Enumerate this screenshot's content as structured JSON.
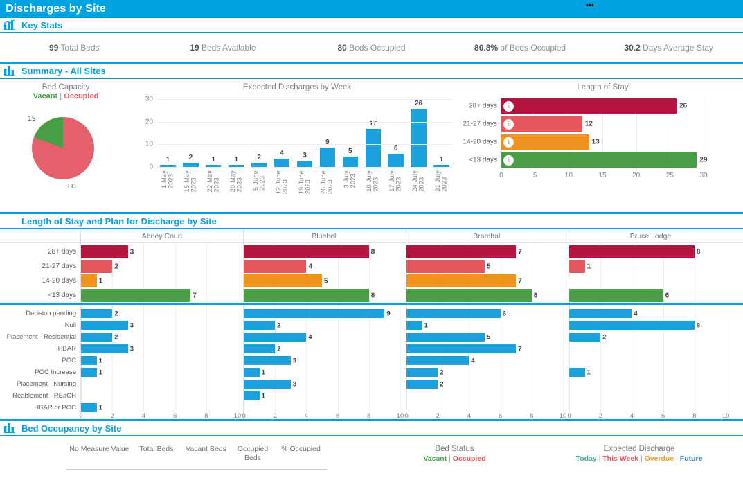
{
  "window": {
    "title": "Discharges by Site",
    "menu_glyph": "•••"
  },
  "key_stats": {
    "section_title": "Key Stats",
    "icon": "bar-chart-trend-icon",
    "stats": [
      {
        "value": "99",
        "label": "Total Beds"
      },
      {
        "value": "19",
        "label": "Beds Available"
      },
      {
        "value": "80",
        "label": "Beds Occupied"
      },
      {
        "value": "80.8%",
        "label": "of Beds Occupied"
      },
      {
        "value": "30.2",
        "label": "Days Average Stay"
      }
    ]
  },
  "summary": {
    "section_title": "Summary - All Sites",
    "icon": "bar-chart-icon",
    "bed_capacity": {
      "title": "Bed Capacity",
      "legend_vacant": "Vacant",
      "legend_sep": "|",
      "legend_occupied": "Occupied",
      "vacant_label": "19",
      "occupied_label": "80"
    }
  },
  "sites_section": {
    "section_title": "Length of Stay and Plan for Discharge by Site",
    "icon": "blank-icon",
    "site_names": [
      "Abney Court",
      "Bluebell",
      "Bramhall",
      "Bruce Lodge"
    ]
  },
  "occupancy": {
    "section_title": "Bed Occupancy by Site",
    "icon": "bar-chart-icon",
    "columns": [
      "No Measure Value",
      "Total Beds",
      "Vacant Beds",
      "Occupied Beds",
      "% Occupied"
    ],
    "bed_status": {
      "title": "Bed Status",
      "vacant": "Vacant",
      "sep": "|",
      "occupied": "Occupied"
    },
    "expected_discharge": {
      "title": "Expected Discharge",
      "today": "Today",
      "this_week": "This Week",
      "overdue": "Overdue",
      "future": "Future",
      "sep": "|"
    }
  },
  "colors": {
    "brand_blue": "#00a2e0",
    "bar_blue": "#1ba1dc",
    "green": "#4a9e46",
    "red": "#e4606a",
    "dark_red": "#b5163f",
    "salmon": "#e8575c",
    "orange": "#f0921e"
  },
  "chart_data": [
    {
      "id": "bed-capacity-pie",
      "type": "pie",
      "title": "Bed Capacity",
      "labels": [
        "Occupied",
        "Vacant"
      ],
      "values": [
        80,
        19
      ],
      "colors": [
        "#e4606a",
        "#4a9e46"
      ],
      "legend": "Vacant | Occupied"
    },
    {
      "id": "expected-discharges-by-week",
      "type": "bar",
      "title": "Expected Discharges by Week",
      "xlabel": "",
      "ylabel": "",
      "ylim": [
        0,
        30
      ],
      "yticks": [
        0,
        10,
        20,
        30
      ],
      "grid": true,
      "categories": [
        "1 May 2023",
        "15 May 2023",
        "22 May 2023",
        "29 May 2023",
        "5 June 2023",
        "12 June 2023",
        "19 June 2023",
        "26 June 2023",
        "3 July 2023",
        "10 July 2023",
        "17 July 2023",
        "24 July 2023",
        "31 July 2023"
      ],
      "values": [
        1,
        2,
        1,
        1,
        2,
        4,
        3,
        9,
        5,
        17,
        6,
        26,
        1
      ]
    },
    {
      "id": "length-of-stay",
      "type": "bar",
      "orientation": "horizontal",
      "title": "Length of Stay",
      "categories": [
        "28+ days",
        "21-27 days",
        "14-20 days",
        "<13 days"
      ],
      "values": [
        26,
        12,
        13,
        29
      ],
      "colors": [
        "#b5163f",
        "#e8575c",
        "#f0921e",
        "#4a9e46"
      ],
      "xlim": [
        0,
        30
      ],
      "xticks": [
        0,
        5,
        10,
        15,
        20,
        25,
        30
      ],
      "grid": true
    },
    {
      "id": "length-of-stay-by-site",
      "type": "bar",
      "orientation": "horizontal",
      "title": "Length of Stay by Site",
      "categories": [
        "28+ days",
        "21-27 days",
        "14-20 days",
        "<13 days"
      ],
      "colors": [
        "#b5163f",
        "#e8575c",
        "#f0921e",
        "#4a9e46"
      ],
      "xlim": [
        0,
        10
      ],
      "series": [
        {
          "name": "Abney Court",
          "values": [
            3,
            2,
            1,
            7
          ]
        },
        {
          "name": "Bluebell",
          "values": [
            8,
            4,
            5,
            8
          ]
        },
        {
          "name": "Bramhall",
          "values": [
            7,
            5,
            7,
            8
          ]
        },
        {
          "name": "Bruce Lodge",
          "values": [
            8,
            1,
            0,
            6
          ]
        }
      ]
    },
    {
      "id": "plan-for-discharge-by-site",
      "type": "bar",
      "orientation": "horizontal",
      "title": "Plan for Discharge by Site",
      "categories": [
        "Decision pending",
        "Null",
        "Placement - Residential",
        "HBAR",
        "POC",
        "POC Increase",
        "Placement - Nursing",
        "Reablement - REaCH",
        "HBAR or POC"
      ],
      "xlim": [
        0,
        10
      ],
      "xticks": [
        0,
        2,
        4,
        6,
        8,
        10
      ],
      "color": "#1ba1dc",
      "series": [
        {
          "name": "Abney Court",
          "values": [
            2,
            3,
            2,
            3,
            1,
            1,
            0,
            0,
            1
          ]
        },
        {
          "name": "Bluebell",
          "values": [
            9,
            2,
            4,
            2,
            3,
            1,
            3,
            1,
            0
          ]
        },
        {
          "name": "Bramhall",
          "values": [
            6,
            1,
            5,
            7,
            4,
            2,
            2,
            0,
            0
          ]
        },
        {
          "name": "Bruce Lodge",
          "values": [
            4,
            8,
            2,
            0,
            0,
            1,
            0,
            0,
            0
          ]
        }
      ]
    }
  ]
}
